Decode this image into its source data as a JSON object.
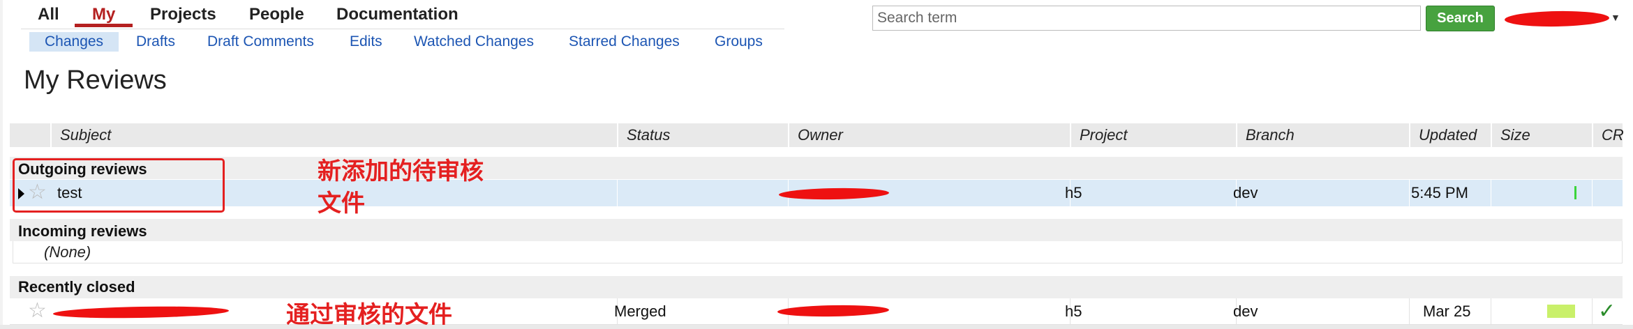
{
  "top_menu": {
    "tabs": [
      {
        "label": "All"
      },
      {
        "label": "My"
      },
      {
        "label": "Projects"
      },
      {
        "label": "People"
      },
      {
        "label": "Documentation"
      }
    ],
    "active": "My"
  },
  "sub_menu": {
    "tabs": [
      {
        "label": "Changes"
      },
      {
        "label": "Drafts"
      },
      {
        "label": "Draft Comments"
      },
      {
        "label": "Edits"
      },
      {
        "label": "Watched Changes"
      },
      {
        "label": "Starred Changes"
      },
      {
        "label": "Groups"
      }
    ],
    "active": "Changes"
  },
  "search": {
    "placeholder": "Search term",
    "button_label": "Search"
  },
  "page_title": "My Reviews",
  "table": {
    "columns": [
      "Subject",
      "Status",
      "Owner",
      "Project",
      "Branch",
      "Updated",
      "Size",
      "CR"
    ],
    "sections": [
      {
        "title": "Outgoing reviews",
        "rows": [
          {
            "subject": "test",
            "status": "",
            "project": "h5",
            "branch": "dev",
            "updated": "5:45 PM"
          }
        ]
      },
      {
        "title": "Incoming reviews",
        "empty_text": "(None)"
      },
      {
        "title": "Recently closed",
        "rows": [
          {
            "subject": "",
            "status": "Merged",
            "project": "h5",
            "branch": "dev",
            "updated": "Mar 25"
          }
        ]
      }
    ]
  },
  "annotations": {
    "new_pending_line1": "新添加的待审核",
    "new_pending_line2": "文件",
    "approved": "通过审核的文件",
    "color": "#e42020"
  },
  "icons": {
    "star": "star-outline-icon",
    "expand": "triangle-right-icon",
    "review_ok": "check-icon"
  },
  "colors": {
    "active_tab": "#b42020",
    "link": "#1c55b3",
    "search_button": "#47a23f",
    "selected_row": "#dbeaf7",
    "size_small": "#3bd43b",
    "size_bar": "#c9f06a",
    "check": "#2a8c2a"
  }
}
